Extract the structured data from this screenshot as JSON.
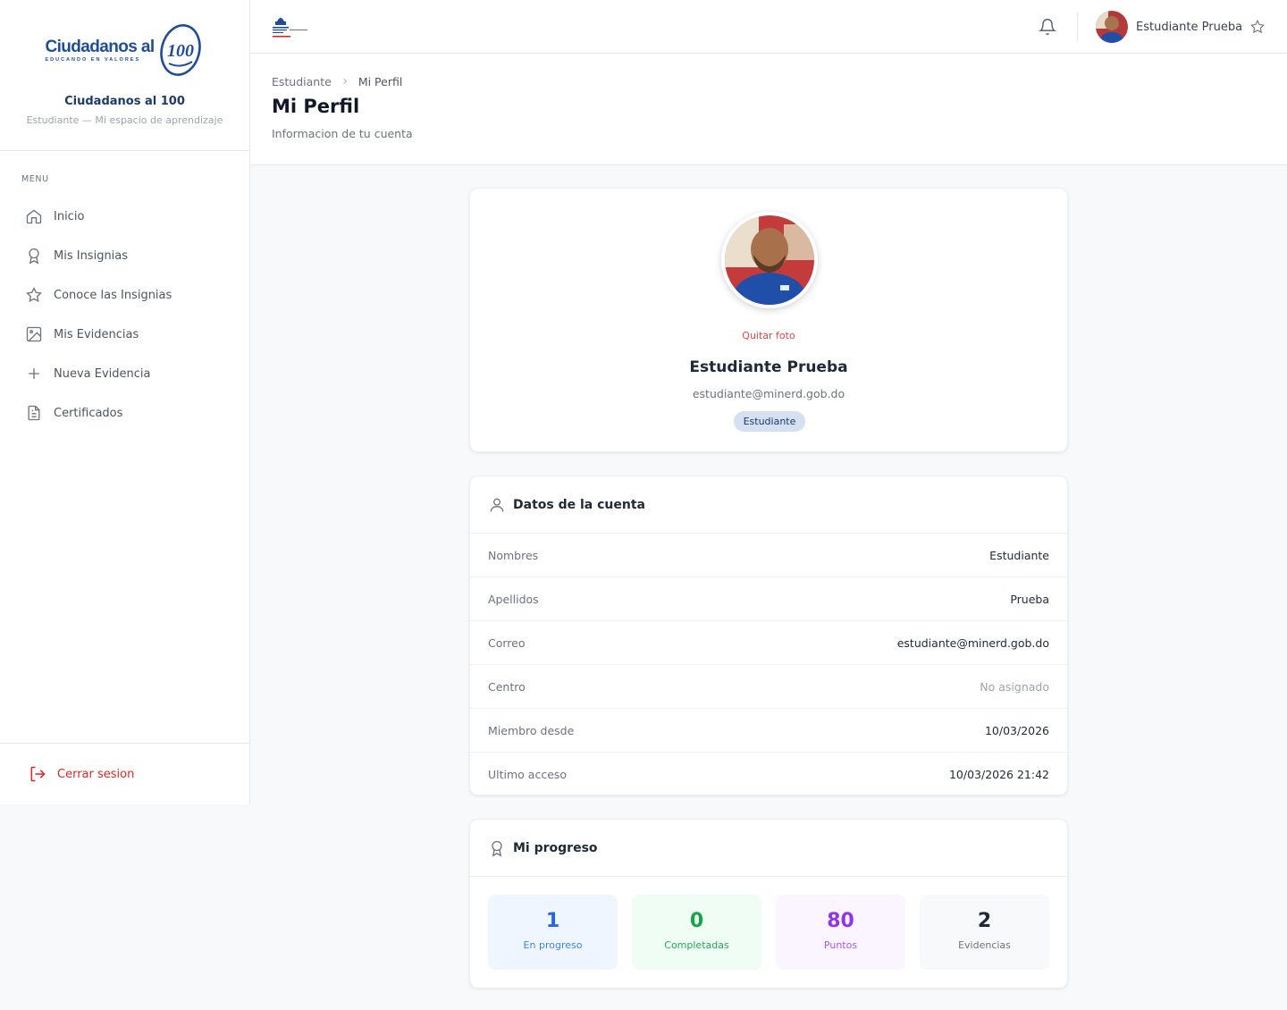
{
  "brand": {
    "logo_main": "Ciudadanos al",
    "logo_number": "100",
    "logo_tagline": "EDUCANDO EN VALORES",
    "title": "Ciudadanos al 100",
    "subtitle": "Estudiante — Mi espacio de aprendizaje"
  },
  "sidebar": {
    "menu_label": "MENU",
    "items": [
      {
        "label": "Inicio",
        "icon": "home-icon"
      },
      {
        "label": "Mis Insignias",
        "icon": "award-icon"
      },
      {
        "label": "Conoce las Insignias",
        "icon": "star-icon"
      },
      {
        "label": "Mis Evidencias",
        "icon": "image-icon"
      },
      {
        "label": "Nueva Evidencia",
        "icon": "plus-icon"
      },
      {
        "label": "Certificados",
        "icon": "document-icon"
      }
    ],
    "logout_label": "Cerrar sesion"
  },
  "topbar": {
    "user_name": "Estudiante Prueba"
  },
  "header": {
    "breadcrumb": [
      "Estudiante",
      "Mi Perfil"
    ],
    "title": "Mi Perfil",
    "subtitle": "Informacion de tu cuenta"
  },
  "profile": {
    "remove_photo_label": "Quitar foto",
    "name": "Estudiante Prueba",
    "email": "estudiante@minerd.gob.do",
    "role": "Estudiante"
  },
  "account": {
    "title": "Datos de la cuenta",
    "rows": [
      {
        "key": "Nombres",
        "value": "Estudiante"
      },
      {
        "key": "Apellidos",
        "value": "Prueba"
      },
      {
        "key": "Correo",
        "value": "estudiante@minerd.gob.do"
      },
      {
        "key": "Centro",
        "value": "No asignado"
      },
      {
        "key": "Miembro desde",
        "value": "10/03/2026"
      },
      {
        "key": "Ultimo acceso",
        "value": "10/03/2026 21:42"
      }
    ]
  },
  "progress": {
    "title": "Mi progreso",
    "stats": [
      {
        "value": "1",
        "label": "En progreso",
        "color": "#2563eb"
      },
      {
        "value": "0",
        "label": "Completadas",
        "color": "#16a34a"
      },
      {
        "value": "80",
        "label": "Puntos",
        "color": "#9333ea"
      },
      {
        "value": "2",
        "label": "Evidencias",
        "color": "#1f2937"
      }
    ]
  },
  "colors": {
    "brand_blue": "#1f4e96",
    "danger": "#dc2626",
    "role_badge_bg": "#d5e0f1"
  }
}
